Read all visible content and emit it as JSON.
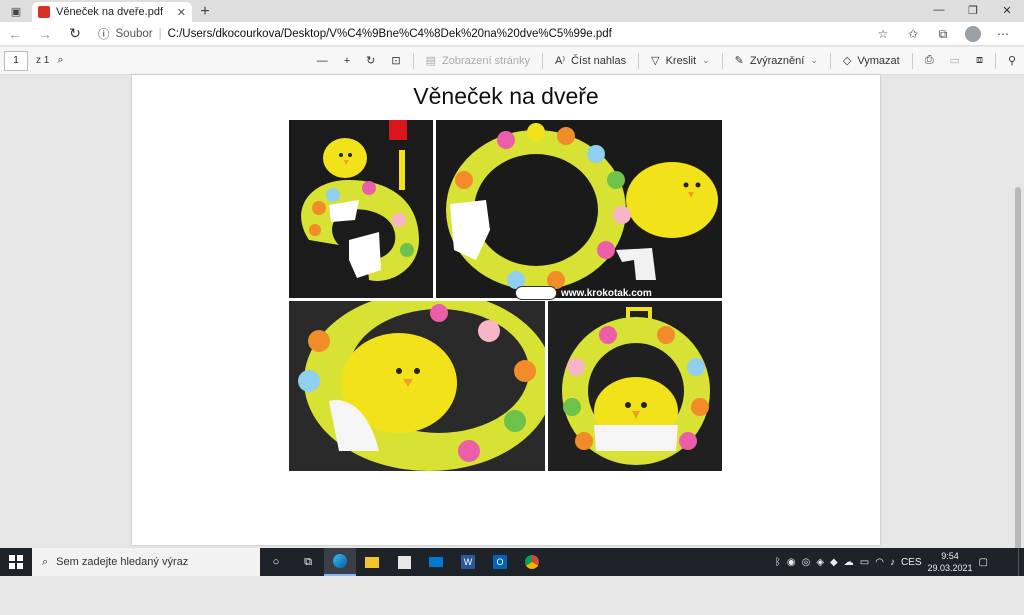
{
  "browser": {
    "tab": {
      "title": "Věneček na dveře.pdf"
    },
    "address": {
      "security_label": "Soubor",
      "path": "C:/Users/dkocourkova/Desktop/V%C4%9Bne%C4%8Dek%20na%20dve%C5%99e.pdf"
    }
  },
  "pdf_toolbar": {
    "page_number": "1",
    "page_count": "z 1",
    "page_view": "Zobrazení stránky",
    "read_aloud": "Číst nahlas",
    "draw": "Kreslit",
    "highlight": "Zvýraznění",
    "erase": "Vymazat"
  },
  "document": {
    "title": "Věneček na dveře",
    "watermark": "www.krokotak.com"
  },
  "taskbar": {
    "search_placeholder": "Sem zadejte hledaný výraz",
    "language": "CES",
    "time": "9:54",
    "date": "29.03.2021"
  },
  "colors": {
    "wreath_yellow": "#d8e234",
    "chick_yellow": "#f2e21a",
    "accent_blue": "#0078d4",
    "taskbar": "#1e2229"
  }
}
